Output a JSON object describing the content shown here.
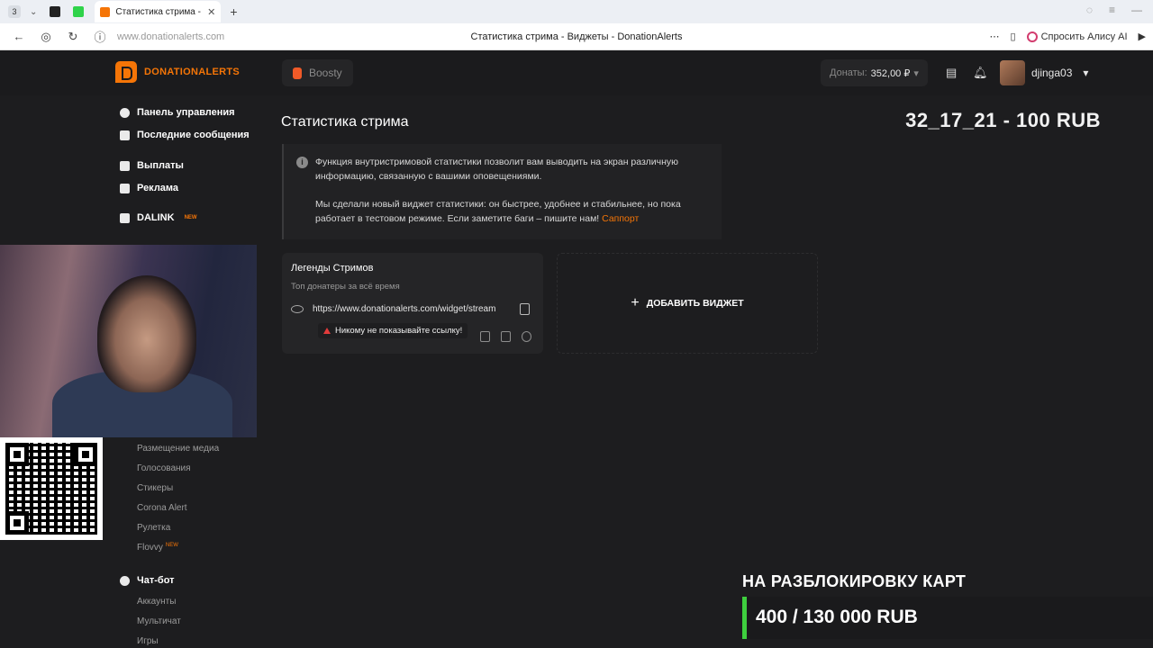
{
  "browser": {
    "tab_count": "3",
    "active_tab_title": "Статистика стрима - В",
    "url": "www.donationalerts.com",
    "page_title": "Статистика стрима - Виджеты - DonationAlerts",
    "alice_label": "Спросить Алису AI"
  },
  "header": {
    "logo": "DONATIONALERTS",
    "boosty": "Boosty",
    "donats_label": "Донаты:",
    "donats_value": "352,00 ₽",
    "username": "djinga03"
  },
  "sidebar": {
    "items": [
      {
        "label": "Панель управления"
      },
      {
        "label": "Последние сообщения"
      },
      {
        "label": "Выплаты"
      },
      {
        "label": "Реклама"
      },
      {
        "label": "DALINK",
        "badge": "NEW"
      }
    ],
    "widgets_sub": [
      "Размещение медиа",
      "Голосования",
      "Стикеры",
      "Corona Alert",
      "Рулетка",
      "Flovvy"
    ],
    "flovvy_badge": "NEW",
    "chatbot": "Чат-бот",
    "chatbot_sub": [
      "Аккаунты",
      "Мультичат",
      "Игры"
    ]
  },
  "main": {
    "title": "Статистика стрима",
    "info_p1": "Функция внутристримовой статистики позволит вам выводить на экран различную информацию, связанную с вашими оповещениями.",
    "info_p2": "Мы сделали новый виджет статистики: он быстрее, удобнее и стабильнее, но пока работает в тестовом режиме. Если заметите баги – пишите нам!",
    "support_link": "Саппорт",
    "card": {
      "title": "Легенды Стримов",
      "subtitle": "Топ донатеры за всё время",
      "url": "https://www.donationalerts.com/widget/stream",
      "warning": "Никому не показывайте ссылку!"
    },
    "add_widget": "ДОБАВИТЬ ВИДЖЕТ"
  },
  "overlay": {
    "top_donor": "32_17_21 - 100 RUB",
    "goal_title": "НА РАЗБЛОКИРОВКУ КАРТ",
    "goal_value": "400 / 130 000 RUB"
  }
}
